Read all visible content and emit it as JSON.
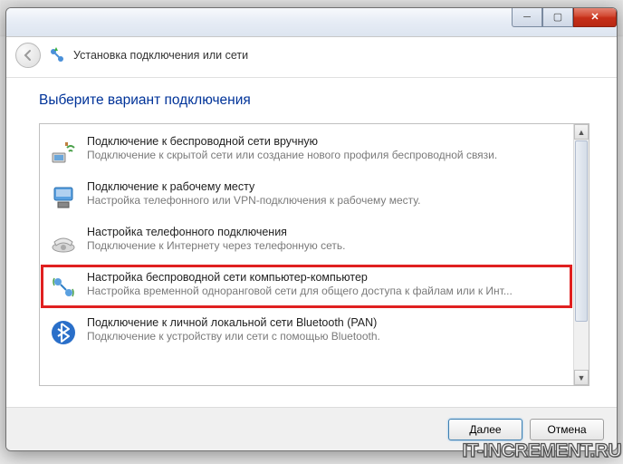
{
  "window": {
    "title": "Установка подключения или сети"
  },
  "page_heading": "Выберите вариант подключения",
  "options": [
    {
      "title": "Подключение к беспроводной сети вручную",
      "desc": "Подключение к скрытой сети или создание нового профиля беспроводной связи.",
      "icon": "wifi-manual-icon"
    },
    {
      "title": "Подключение к рабочему месту",
      "desc": "Настройка телефонного или VPN-подключения к рабочему месту.",
      "icon": "workplace-icon"
    },
    {
      "title": "Настройка телефонного подключения",
      "desc": "Подключение к Интернету через телефонную сеть.",
      "icon": "dialup-icon"
    },
    {
      "title": "Настройка беспроводной сети компьютер-компьютер",
      "desc": "Настройка временной одноранговой сети для общего доступа к файлам или к Инт...",
      "icon": "adhoc-icon",
      "highlighted": true
    },
    {
      "title": "Подключение к личной локальной сети Bluetooth (PAN)",
      "desc": "Подключение к устройству или сети с помощью Bluetooth.",
      "icon": "bluetooth-icon"
    }
  ],
  "buttons": {
    "next": "Далее",
    "cancel": "Отмена"
  },
  "watermark": "IT-INCREMENT.RU"
}
